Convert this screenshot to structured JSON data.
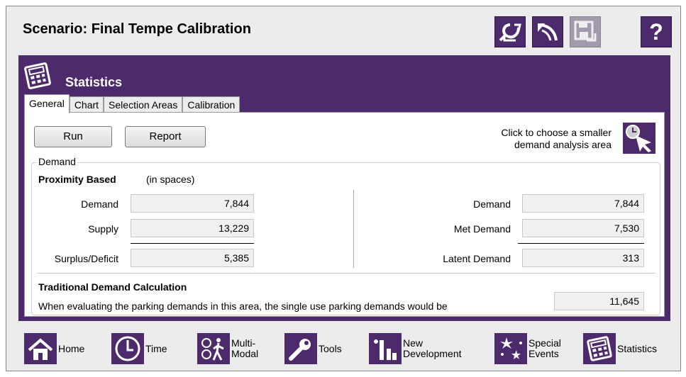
{
  "scenario": {
    "title": "Scenario: Final Tempe Calibration"
  },
  "top_buttons": [
    {
      "name": "scenario-back-icon",
      "disabled": false
    },
    {
      "name": "scenario-undo-icon",
      "disabled": false
    },
    {
      "name": "save-icon",
      "disabled": true
    },
    {
      "name": "help-icon",
      "disabled": false,
      "glyph": "?"
    }
  ],
  "statistics": {
    "title": "Statistics",
    "tabs": [
      {
        "label": "General",
        "active": true
      },
      {
        "label": "Chart",
        "active": false
      },
      {
        "label": "Selection Areas",
        "active": false
      },
      {
        "label": "Calibration",
        "active": false
      }
    ],
    "run_label": "Run",
    "report_label": "Report",
    "hint_line1": "Click to choose a smaller",
    "hint_line2": "demand analysis area",
    "demand_group": "Demand",
    "proximity_title": "Proximity Based",
    "proximity_unit": "(in spaces)",
    "left": {
      "demand_label": "Demand",
      "demand_value": "7,844",
      "supply_label": "Supply",
      "supply_value": "13,229",
      "surplus_label": "Surplus/Deficit",
      "surplus_value": "5,385"
    },
    "right": {
      "demand_label": "Demand",
      "demand_value": "7,844",
      "met_label": "Met Demand",
      "met_value": "7,530",
      "latent_label": "Latent Demand",
      "latent_value": "313"
    },
    "traditional_title": "Traditional Demand Calculation",
    "traditional_text": "When evaluating the parking demands in this area, the single use parking demands would be",
    "traditional_value": "11,645"
  },
  "nav": {
    "home": "Home",
    "time": "Time",
    "multimodal": "Multi-\nModal",
    "tools": "Tools",
    "new_development": "New\nDevelopment",
    "special_events": "Special\nEvents",
    "statistics": "Statistics"
  },
  "colors": {
    "accent": "#4d2a6b",
    "panel_bg": "#ececec"
  }
}
